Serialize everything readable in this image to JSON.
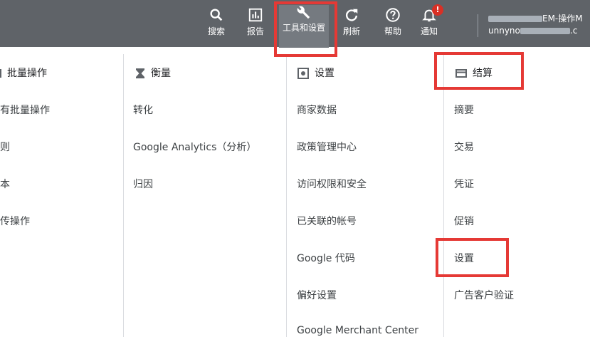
{
  "toolbar": {
    "search": "搜索",
    "report": "报告",
    "tools": "工具和设置",
    "refresh": "刷新",
    "help": "帮助",
    "notify": "通知",
    "notify_badge": "!",
    "account_line1": "EM-操作M",
    "account_line2": "unnyno",
    "account_line2_tail": ".c"
  },
  "columns": {
    "bulk": {
      "heading": "批量操作",
      "items": [
        "有批量操作",
        "则",
        "本",
        "传操作"
      ]
    },
    "measure": {
      "heading": "衡量",
      "items": [
        "转化",
        "Google Analytics（分析）",
        "归因"
      ]
    },
    "settings": {
      "heading": "设置",
      "items": [
        "商家数据",
        "政策管理中心",
        "访问权限和安全",
        "已关联的帐号",
        "Google 代码",
        "偏好设置",
        "Google Merchant Center"
      ]
    },
    "billing": {
      "heading": "结算",
      "items": [
        "摘要",
        "交易",
        "凭证",
        "促销",
        "设置",
        "广告客户验证"
      ]
    }
  },
  "colors": {
    "toolbar": "#5f6368",
    "highlight": "#e53935",
    "badge": "#d93025"
  }
}
